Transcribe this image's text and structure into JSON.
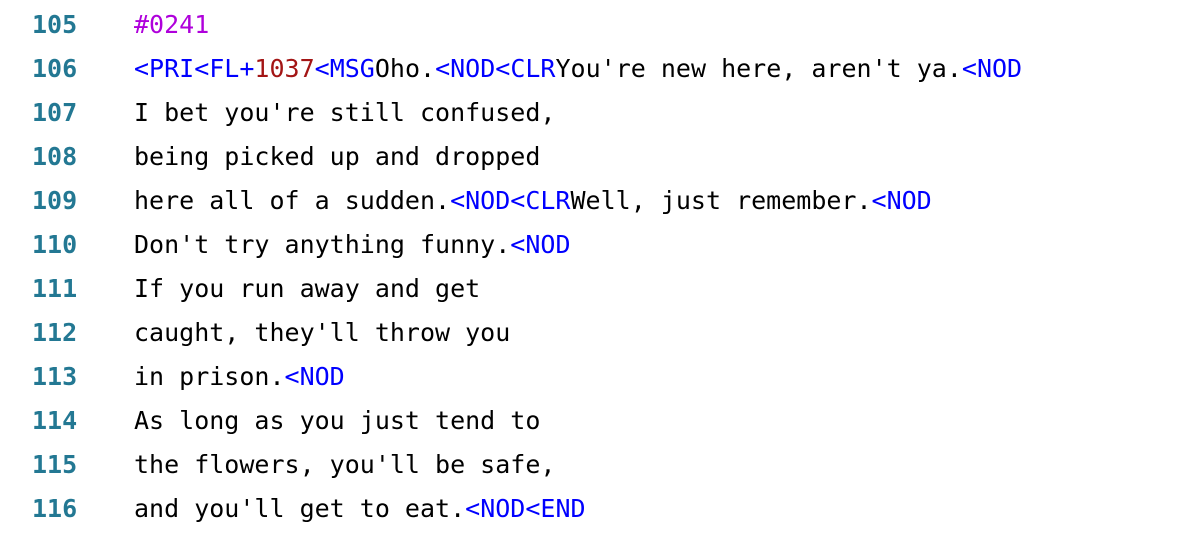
{
  "colors": {
    "line_number": "#237893",
    "event": "#af00db",
    "command": "#0000ff",
    "number": "#a31515",
    "text": "#000000",
    "background": "#ffffff"
  },
  "lines": [
    {
      "number": "105",
      "tokens": [
        {
          "type": "event",
          "text": "#0241"
        }
      ]
    },
    {
      "number": "106",
      "tokens": [
        {
          "type": "cmd",
          "text": "<PRI<FL+"
        },
        {
          "type": "num",
          "text": "1037"
        },
        {
          "type": "cmd",
          "text": "<MSG"
        },
        {
          "type": "text",
          "text": "Oho."
        },
        {
          "type": "cmd",
          "text": "<NOD<CLR"
        },
        {
          "type": "text",
          "text": "You're new here, aren't ya."
        },
        {
          "type": "cmd",
          "text": "<NOD"
        }
      ]
    },
    {
      "number": "107",
      "tokens": [
        {
          "type": "text",
          "text": "I bet you're still confused,"
        }
      ]
    },
    {
      "number": "108",
      "tokens": [
        {
          "type": "text",
          "text": "being picked up and dropped"
        }
      ]
    },
    {
      "number": "109",
      "tokens": [
        {
          "type": "text",
          "text": "here all of a sudden."
        },
        {
          "type": "cmd",
          "text": "<NOD<CLR"
        },
        {
          "type": "text",
          "text": "Well, just remember."
        },
        {
          "type": "cmd",
          "text": "<NOD"
        }
      ]
    },
    {
      "number": "110",
      "tokens": [
        {
          "type": "text",
          "text": "Don't try anything funny."
        },
        {
          "type": "cmd",
          "text": "<NOD"
        }
      ]
    },
    {
      "number": "111",
      "tokens": [
        {
          "type": "text",
          "text": "If you run away and get"
        }
      ]
    },
    {
      "number": "112",
      "tokens": [
        {
          "type": "text",
          "text": "caught, they'll throw you"
        }
      ]
    },
    {
      "number": "113",
      "tokens": [
        {
          "type": "text",
          "text": "in prison."
        },
        {
          "type": "cmd",
          "text": "<NOD"
        }
      ]
    },
    {
      "number": "114",
      "tokens": [
        {
          "type": "text",
          "text": "As long as you just tend to"
        }
      ]
    },
    {
      "number": "115",
      "tokens": [
        {
          "type": "text",
          "text": "the flowers, you'll be safe,"
        }
      ]
    },
    {
      "number": "116",
      "tokens": [
        {
          "type": "text",
          "text": "and you'll get to eat."
        },
        {
          "type": "cmd",
          "text": "<NOD<END"
        }
      ]
    }
  ]
}
